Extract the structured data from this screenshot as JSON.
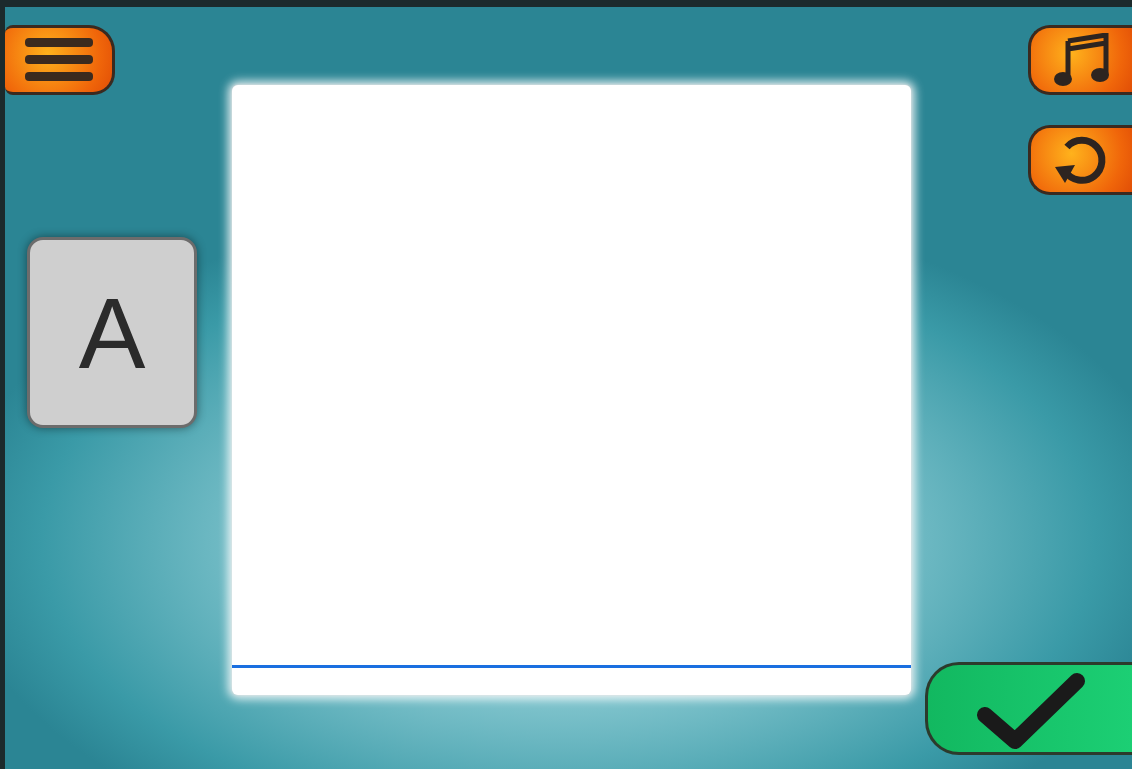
{
  "letter_card": {
    "letter": "A"
  }
}
